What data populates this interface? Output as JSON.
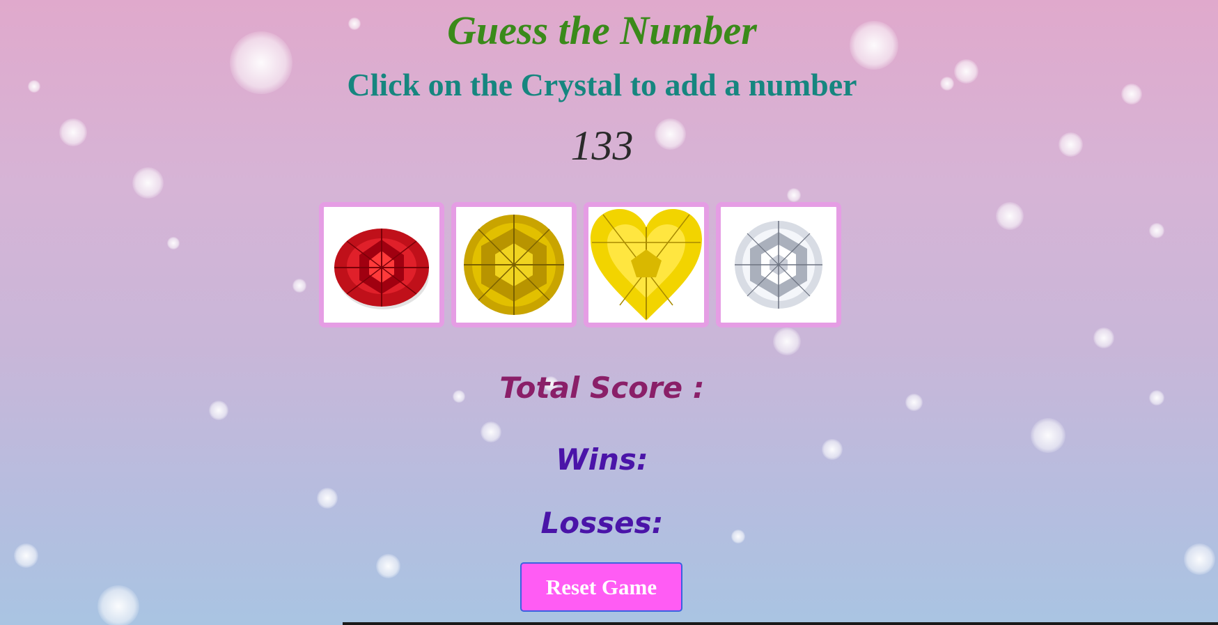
{
  "game": {
    "title": "Guess the Number",
    "instructions": "Click on the Crystal to add a number",
    "target_number": "133",
    "total_score_label": "Total Score :",
    "wins_label": "Wins:",
    "losses_label": "Losses:",
    "reset_label": "Reset Game"
  },
  "crystals": [
    {
      "name": "red-ruby",
      "color": "#c0101a"
    },
    {
      "name": "yellow-round-gem",
      "color": "#d4b000"
    },
    {
      "name": "yellow-heart-gem",
      "color": "#f2d400"
    },
    {
      "name": "white-diamond",
      "color": "#d8dce4"
    }
  ],
  "colors": {
    "title": "#3a8a1a",
    "instructions": "#16867f",
    "total_score": "#8a1f68",
    "wins_losses": "#4a14a8",
    "reset_button": "#ff5cf4",
    "crystal_border": "#e59de4"
  }
}
